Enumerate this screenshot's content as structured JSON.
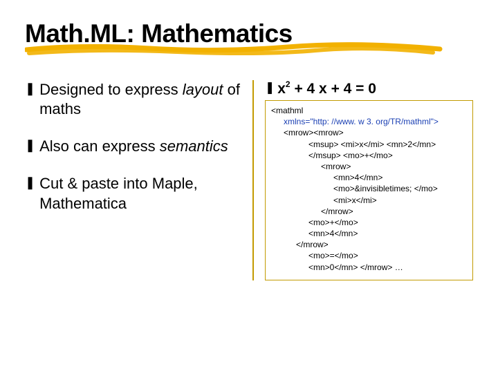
{
  "title": "Math.ML: Mathematics",
  "left_bullets": [
    {
      "pre": "Designed to express ",
      "em": "layout",
      "post": " of maths"
    },
    {
      "pre": "Also can express ",
      "em": "semantics",
      "post": ""
    },
    {
      "pre": "Cut & paste into Maple, Mathematica",
      "em": "",
      "post": ""
    }
  ],
  "equation": {
    "base1": "x",
    "exp": "2",
    "rest": " + 4 x + 4 = 0"
  },
  "code": {
    "root_open": "<mathml",
    "ns": "xmlns=\"http: //www. w 3. org/TR/mathml\">",
    "lines": [
      {
        "lvl": 1,
        "text": "<mrow><mrow>"
      },
      {
        "lvl": 3,
        "text": "<msup> <mi>x</mi> <mn>2</mn>"
      },
      {
        "lvl": 3,
        "text": "</msup> <mo>+</mo>"
      },
      {
        "lvl": 4,
        "text": "<mrow>"
      },
      {
        "lvl": 5,
        "text": "<mn>4</mn>"
      },
      {
        "lvl": 5,
        "text": "<mo>&invisibletimes; </mo>"
      },
      {
        "lvl": 5,
        "text": "<mi>x</mi>"
      },
      {
        "lvl": 4,
        "text": "</mrow>"
      },
      {
        "lvl": 3,
        "text": "<mo>+</mo>"
      },
      {
        "lvl": 3,
        "text": "<mn>4</mn>"
      },
      {
        "lvl": 2,
        "text": "</mrow>"
      },
      {
        "lvl": 3,
        "text": "<mo>=</mo>"
      },
      {
        "lvl": 3,
        "text": "<mn>0</mn> </mrow> …"
      }
    ]
  },
  "bullet_glyph": "❚"
}
